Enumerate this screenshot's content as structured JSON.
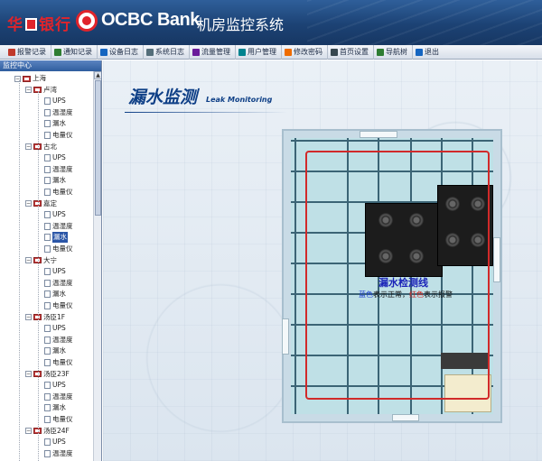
{
  "header": {
    "bank_cn_a": "华",
    "bank_cn_b": "银行",
    "bank_en": "OCBC Bank",
    "system_title": "机房监控系统"
  },
  "toolbar": {
    "items": [
      {
        "label": "报警记录",
        "icon_color": "#c0392b"
      },
      {
        "label": "通知记录",
        "icon_color": "#2e7d32"
      },
      {
        "label": "设备日志",
        "icon_color": "#1565c0"
      },
      {
        "label": "系统日志",
        "icon_color": "#546e7a"
      },
      {
        "label": "流量管理",
        "icon_color": "#6a1b9a"
      },
      {
        "label": "用户管理",
        "icon_color": "#00838f"
      },
      {
        "label": "修改密码",
        "icon_color": "#ef6c00"
      },
      {
        "label": "首页设置",
        "icon_color": "#37474f"
      },
      {
        "label": "导航树",
        "icon_color": "#2e7d32"
      },
      {
        "label": "退出",
        "icon_color": "#1565c0"
      }
    ]
  },
  "sidebar": {
    "title": "监控中心",
    "root": "上海",
    "groups": [
      {
        "name": "卢湾",
        "items": [
          "UPS",
          "温湿度",
          "漏水",
          "电量仪"
        ]
      },
      {
        "name": "古北",
        "items": [
          "UPS",
          "温湿度",
          "漏水",
          "电量仪"
        ]
      },
      {
        "name": "嘉定",
        "items": [
          "UPS",
          "温湿度",
          "漏水",
          "电量仪"
        ]
      },
      {
        "name": "大宁",
        "items": [
          "UPS",
          "温湿度",
          "漏水",
          "电量仪"
        ]
      },
      {
        "name": "汤臣1F",
        "items": [
          "UPS",
          "温湿度",
          "漏水",
          "电量仪"
        ]
      },
      {
        "name": "汤臣23F",
        "items": [
          "UPS",
          "温湿度",
          "漏水",
          "电量仪"
        ]
      },
      {
        "name": "汤臣24F",
        "items": [
          "UPS",
          "温湿度"
        ]
      }
    ],
    "selected": {
      "group": 2,
      "item": 2
    }
  },
  "main": {
    "title_cn": "漏水监测",
    "title_en": "Leak Monitoring",
    "legend_title": "漏水检测线",
    "legend_blue_word": "蓝色",
    "legend_part1": "表示正常，",
    "legend_red_word": "红色",
    "legend_part2": "表示报警"
  },
  "colors": {
    "detect_line": "#d12a2a",
    "floor": "#bfe0e6",
    "grid": "#3b6475",
    "rack": "#1c1c1c"
  }
}
